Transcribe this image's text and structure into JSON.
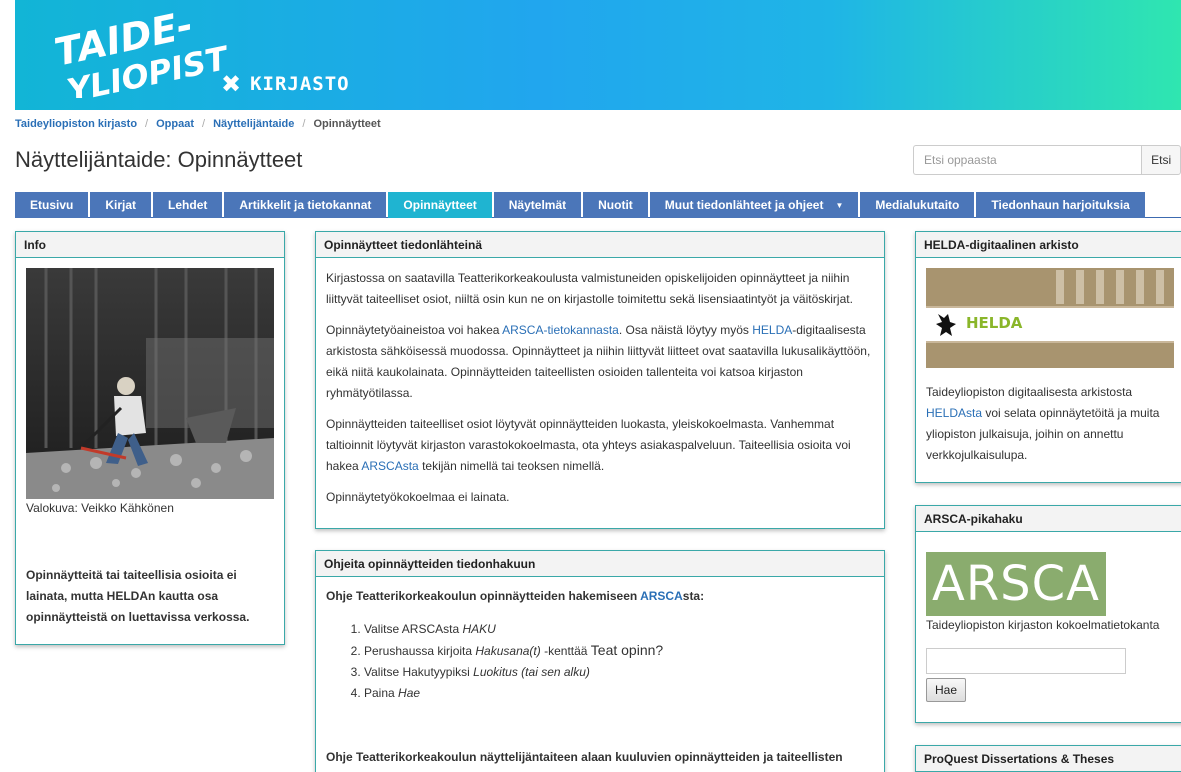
{
  "banner": {
    "logo_line1": "TAIDE-",
    "logo_line2": "YLIOPISTO",
    "library_label": "KIRJASTO",
    "colors": {
      "from": "#12b5d6",
      "to": "#2fe6b0"
    }
  },
  "breadcrumb": {
    "items": [
      "Taideyliopiston kirjasto",
      "Oppaat",
      "Näyttelijäntaide"
    ],
    "current": "Opinnäytteet"
  },
  "page_title": "Näyttelijäntaide: Opinnäytteet",
  "search": {
    "placeholder": "Etsi oppaasta",
    "button": "Etsi"
  },
  "tabs": [
    {
      "label": "Etusivu"
    },
    {
      "label": "Kirjat"
    },
    {
      "label": "Lehdet"
    },
    {
      "label": "Artikkelit ja tietokannat"
    },
    {
      "label": "Opinnäytteet",
      "active": true
    },
    {
      "label": "Näytelmät"
    },
    {
      "label": "Nuotit"
    },
    {
      "label": "Muut tiedonlähteet ja ohjeet",
      "dropdown": true
    },
    {
      "label": "Medialukutaito"
    },
    {
      "label": "Tiedonhaun harjoituksia"
    }
  ],
  "info": {
    "title": "Info",
    "caption": "Valokuva: Veikko Kähkönen",
    "text": "Opinnäytteitä tai taiteellisia osioita ei lainata, mutta HELDAn kautta osa opinnäytteistä on luettavissa verkossa."
  },
  "sources": {
    "title": "Opinnäytteet tiedonlähteinä",
    "p1": "Kirjastossa on saatavilla Teatterikorkeakoulusta valmistuneiden opiskelijoiden opinnäytteet ja niihin liittyvät taiteelliset osiot, niiltä osin kun ne on kirjastolle toimitettu sekä lisensiaatintyöt ja väitöskirjat.",
    "p2_a": "Opinnäytetyöaineistoa voi hakea ",
    "p2_link1": "ARSCA-tietokannasta",
    "p2_b": ". Osa näistä löytyy myös ",
    "p2_link2": "HELDA",
    "p2_c": "-digitaalisesta arkistosta sähköisessä muodossa. Opinnäytteet ja niihin liittyvät liitteet ovat saatavilla lukusalikäyttöön, eikä niitä kaukolainata. Opinnäytteiden taiteellisten osioiden tallenteita voi katsoa kirjaston ryhmätyötilassa.",
    "p3_a": "Opinnäytteiden taiteelliset osiot löytyvät opinnäytteiden luokasta, yleiskokoelmasta. Vanhemmat taltioinnit löytyvät kirjaston varastokokoelmasta, ota yhteys asiakaspalveluun. Taiteellisia osioita voi hakea ",
    "p3_link": "ARSCAsta",
    "p3_b": " tekijän nimellä tai teoksen nimellä.",
    "p4": "Opinnäytetyökokoelmaa ei lainata."
  },
  "guides": {
    "title": "Ohjeita opinnäytteiden tiedonhakuun",
    "intro_a": "Ohje Teatterikorkeakoulun opinnäytteiden hakemiseen ",
    "intro_link": "ARSCA",
    "intro_b": "sta:",
    "step1_a": "Valitse ARSCAsta ",
    "step1_em": "HAKU",
    "step2_a": "Perushaussa kirjoita ",
    "step2_em": "Hakusana(t)",
    "step2_b": " -kenttää ",
    "step2_big": "Teat opinn?",
    "step3_a": "Valitse Hakutyypiksi ",
    "step3_em": "Luokitus (tai sen alku)",
    "step4_a": "Paina ",
    "step4_em": "Hae",
    "intro2": "Ohje Teatterikorkeakoulun näyttelijäntaiteen alaan kuuluvien opinnäytteiden ja taiteellisten"
  },
  "helda": {
    "title": "HELDA-digitaalinen arkisto",
    "logo_text": "HELDA",
    "text_a": "Taideyliopiston digitaalisesta arkistosta ",
    "text_link": "HELDAsta",
    "text_b": " voi selata opinnäytetöitä ja muita yliopiston julkaisuja, joihin on annettu verkkojulkaisulupa."
  },
  "arsca": {
    "title": "ARSCA-pikahaku",
    "logo_text": "ARSCA",
    "caption": "Taideyliopiston kirjaston kokoelmatietokanta",
    "button": "Hae"
  },
  "proquest": {
    "title": "ProQuest Dissertations & Theses"
  }
}
